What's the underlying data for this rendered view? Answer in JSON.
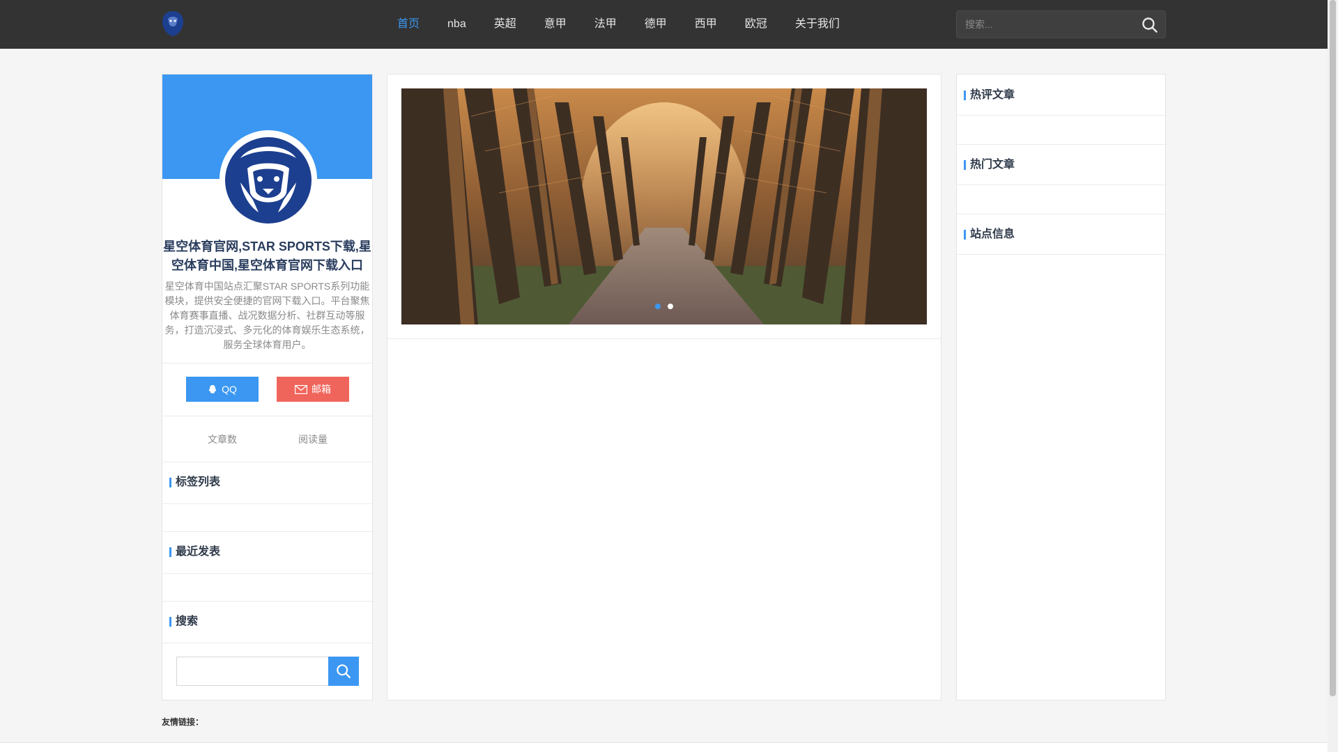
{
  "nav": {
    "items": [
      {
        "label": "首页",
        "active": true
      },
      {
        "label": "nba"
      },
      {
        "label": "英超"
      },
      {
        "label": "意甲"
      },
      {
        "label": "法甲"
      },
      {
        "label": "德甲"
      },
      {
        "label": "西甲"
      },
      {
        "label": "欧冠"
      },
      {
        "label": "关于我们"
      }
    ],
    "search_placeholder": "搜索..."
  },
  "profile": {
    "title": "星空体育官网,STAR SPORTS下载,星空体育中国,星空体育官网下载入口",
    "description": "星空体育中国站点汇聚STAR SPORTS系列功能模块，提供安全便捷的官网下载入口。平台聚焦体育赛事直播、战况数据分析、社群互动等服务，打造沉浸式、多元化的体育娱乐生态系统，服务全球体育用户。",
    "qq_label": "QQ",
    "mail_label": "邮箱",
    "stat_articles": "文章数",
    "stat_views": "阅读量"
  },
  "left_widgets": {
    "tags": "标签列表",
    "recent": "最近发表",
    "search": "搜索"
  },
  "right_widgets": {
    "hot_comments": "热评文章",
    "hot_articles": "热门文章",
    "site_info": "站点信息"
  },
  "carousel": {
    "active_slide": 1,
    "slide_count": 2
  },
  "footer": {
    "links_label": "友情链接："
  },
  "colors": {
    "accent": "#3b97f1",
    "nav_bg": "#333333",
    "mail_button": "#f0655b"
  }
}
